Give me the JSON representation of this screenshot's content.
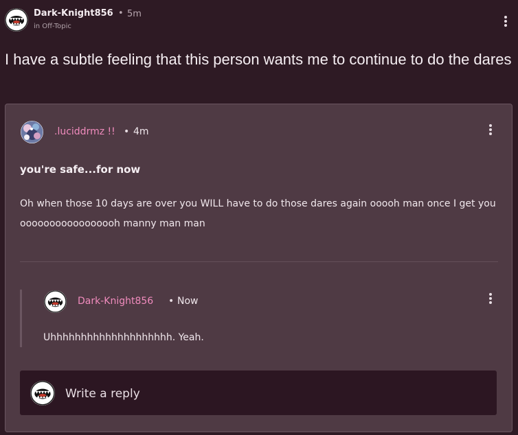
{
  "post": {
    "author": "Dark-Knight856",
    "separator": "•",
    "time": "5m",
    "board": "in Off-Topic",
    "title": "I have a subtle feeling that this person wants me to continue to do the dares"
  },
  "comment": {
    "author": ".luciddrmz !!",
    "separator": "•",
    "time": "4m",
    "heading": "you're safe...for now",
    "body": "Oh when those 10 days are over you WILL have to do those dares again ooooh man once I get you ooooooooooooooooh manny man man"
  },
  "reply": {
    "author": "Dark-Knight856",
    "separator": "•",
    "time": "Now",
    "body": "Uhhhhhhhhhhhhhhhhhhhh. Yeah."
  },
  "composer": {
    "placeholder": "Write a reply"
  },
  "icons": {
    "menu": "more-vertical-icon",
    "avatar_self": "monster-mouth-avatar",
    "avatar_other": "galaxy-avatar"
  },
  "colors": {
    "background": "#2e1a24",
    "card": "#4f3a44",
    "username_accent": "#f08bbd",
    "composer": "#2c1622"
  }
}
